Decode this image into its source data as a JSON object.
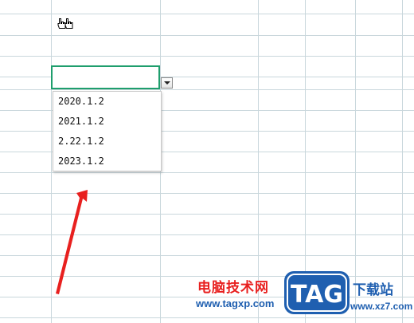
{
  "dropdown": {
    "options": [
      "2020.1.2",
      "2021.1.2",
      "2.22.1.2",
      "2023.1.2"
    ],
    "button_icon": "chevron-down-icon"
  },
  "selected_cell": {
    "value": "",
    "border_color": "#1f9e6d"
  },
  "cursor": {
    "icon": "hand-pointer-icon"
  },
  "annotation": {
    "icon": "red-arrow-icon",
    "color": "#e8201f"
  },
  "watermark": {
    "site_name_cn": "电脑技术网",
    "site_url": "www.tagxp.com",
    "logo_text": "TAG",
    "download_cn": "下载站",
    "download_url": "www.xz7.com"
  }
}
